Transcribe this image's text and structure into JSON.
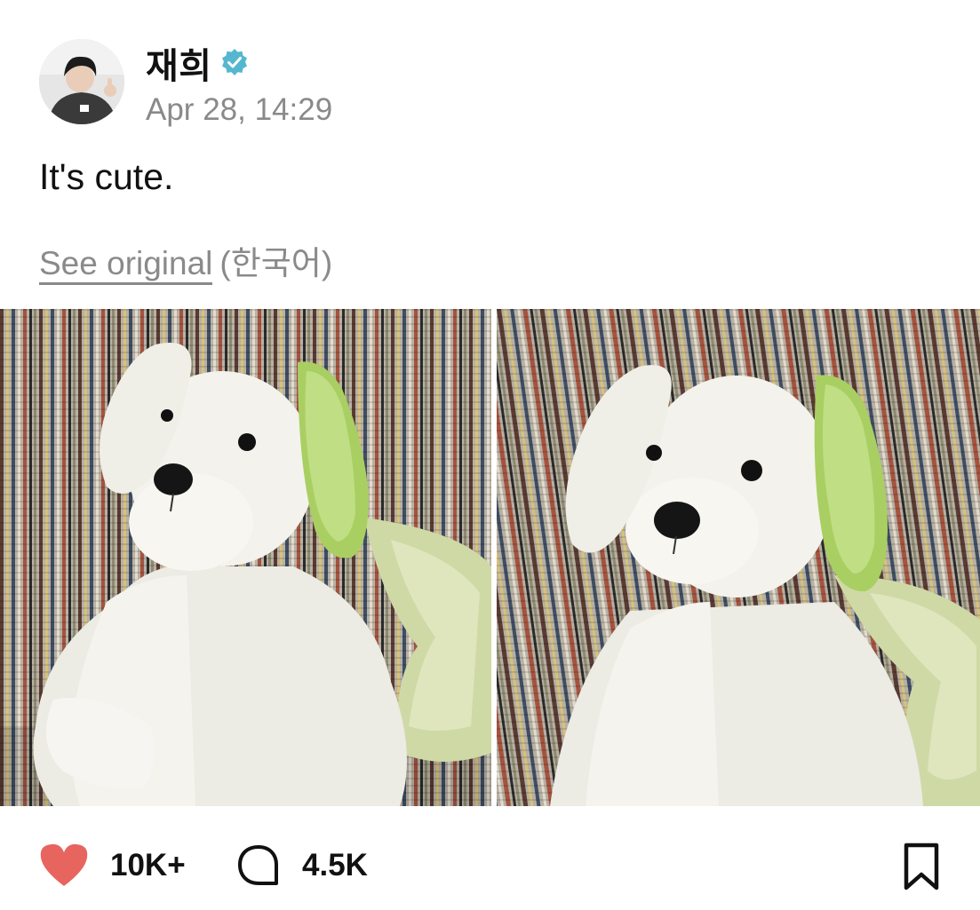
{
  "post": {
    "author": {
      "name": "재희",
      "verified": true,
      "verified_color": "#55b7cf",
      "avatar_icon": "avatar-photo"
    },
    "timestamp": "Apr 28, 14:29",
    "text": "It's cute.",
    "translation": {
      "see_original_label": "See original",
      "language_label": "(한국어)"
    },
    "media": [
      {
        "type": "photo",
        "subject": "white plush puppy with green ear on striped couch"
      },
      {
        "type": "photo",
        "subject": "white plush puppy with green ear on striped couch, closer"
      }
    ]
  },
  "actions": {
    "like": {
      "icon": "heart-icon",
      "count": "10K+",
      "color": "#e8655f"
    },
    "comment": {
      "icon": "comment-bubble-icon",
      "count": "4.5K"
    },
    "bookmark": {
      "icon": "bookmark-icon"
    }
  }
}
